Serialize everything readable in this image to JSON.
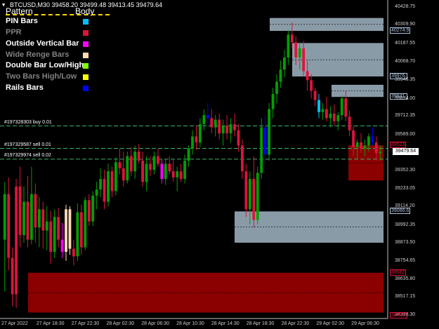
{
  "header": {
    "symbol_info": "BTCUSD,M30  39458.20  39499.48  39413.45  39479.64",
    "menu_arrow": "▼"
  },
  "legend": {
    "title_pattern": "Pattern",
    "title_body": "Body",
    "items": [
      {
        "label": "PIN Bars",
        "text_color": "#ffffff",
        "swatch": "#00bfff"
      },
      {
        "label": "PPR",
        "text_color": "#808080",
        "swatch": "#dc143c"
      },
      {
        "label": "Outside Vertical Bar",
        "text_color": "#ffffff",
        "swatch": "#ff00ff"
      },
      {
        "label": "Wide Renge Bars",
        "text_color": "#808080",
        "swatch": "#ffdab9"
      },
      {
        "label": "Double Bar Low/High",
        "text_color": "#ffffff",
        "swatch": "#7cfc00"
      },
      {
        "label": "Two Bars High/Low",
        "text_color": "#808080",
        "swatch": "#ffff00"
      },
      {
        "label": "Rails Bars",
        "text_color": "#ffffff",
        "swatch": "#0000ff"
      }
    ]
  },
  "orders": [
    {
      "label": "#197328303 buy 0.01",
      "price": 39649
    },
    {
      "label": "#197329587 sell 0.01",
      "price": 39501
    },
    {
      "label": "#197329974 sell 0.02",
      "price": 39430
    }
  ],
  "price_axis": {
    "ticks": [
      "40428.75",
      "40309.90",
      "40187.55",
      "40068.70",
      "39946.35",
      "39824.00",
      "39712.35",
      "39589.00",
      "39470.15",
      "39352.30",
      "39233.05",
      "39114.20",
      "38992.35",
      "38873.50",
      "38754.65",
      "38635.80",
      "38517.15",
      "38398.30"
    ],
    "current_price": "39479.64",
    "zone_labels": [
      {
        "text": "40274.9",
        "price": 40275,
        "color": "#b0c4de"
      },
      {
        "text": "39976.",
        "price": 39975,
        "color": "#b0c4de"
      },
      {
        "text": "39841.",
        "price": 39840,
        "color": "#b0c4de"
      },
      {
        "text": "39523",
        "price": 39521,
        "color": "#dc143c"
      },
      {
        "text": "39086.6",
        "price": 39086,
        "color": "#b0c4de"
      },
      {
        "text": "38682",
        "price": 38682,
        "color": "#dc143c"
      },
      {
        "text": "38400.",
        "price": 38400,
        "color": "#dc143c"
      }
    ]
  },
  "time_axis": {
    "ticks": [
      "27 Apr 2022",
      "27 Apr 18:30",
      "27 Apr 22:30",
      "28 Apr 02:30",
      "28 Apr 06:30",
      "28 Apr 10:30",
      "28 Apr 14:30",
      "28 Apr 18:30",
      "28 Apr 22:30",
      "29 Apr 02:30",
      "29 Apr 06:30"
    ]
  },
  "colors": {
    "bull": "#00a000",
    "bear": "#dc143c",
    "supply_zone": "#8a9ba8",
    "demand_zone": "#8b0000",
    "order_line": "#3cb371"
  },
  "chart_data": {
    "type": "candlestick",
    "ylim": [
      38390,
      40460
    ],
    "candles": [
      [
        38900,
        39280,
        38560,
        39200
      ],
      [
        39200,
        39310,
        38700,
        38780
      ],
      [
        38780,
        38850,
        38460,
        38540
      ],
      [
        38540,
        39300,
        38450,
        39250
      ],
      [
        39250,
        39380,
        38850,
        38930
      ],
      [
        38930,
        39250,
        38880,
        39150
      ],
      [
        39150,
        39320,
        38850,
        38900
      ],
      [
        38900,
        39380,
        38870,
        39200
      ],
      [
        39200,
        39270,
        38880,
        38980
      ],
      [
        38980,
        39180,
        38850,
        39100
      ],
      [
        39100,
        39150,
        38840,
        38960
      ],
      [
        38960,
        39120,
        38830,
        39020
      ],
      [
        39020,
        39090,
        38740,
        38820
      ],
      [
        38820,
        39100,
        38780,
        39050
      ],
      [
        39050,
        39110,
        38850,
        38900
      ],
      [
        38900,
        39010,
        38780,
        38820
      ],
      [
        38820,
        39130,
        38760,
        39100
      ],
      [
        39100,
        39120,
        38800,
        38840
      ],
      [
        38840,
        38900,
        38730,
        38790
      ],
      [
        38790,
        39140,
        38760,
        39080
      ],
      [
        39080,
        39130,
        38800,
        38850
      ],
      [
        38850,
        39180,
        38830,
        39160
      ],
      [
        39160,
        39200,
        38990,
        39020
      ],
      [
        39020,
        39220,
        38990,
        39190
      ],
      [
        39190,
        39280,
        39100,
        39230
      ],
      [
        39230,
        39370,
        39180,
        39300
      ],
      [
        39300,
        39360,
        39100,
        39150
      ],
      [
        39150,
        39400,
        39120,
        39350
      ],
      [
        39350,
        39380,
        39180,
        39220
      ],
      [
        39220,
        39440,
        39190,
        39410
      ],
      [
        39410,
        39500,
        39330,
        39370
      ],
      [
        39370,
        39480,
        39250,
        39290
      ],
      [
        39290,
        39480,
        39270,
        39450
      ],
      [
        39450,
        39510,
        39320,
        39350
      ],
      [
        39350,
        39520,
        39300,
        39480
      ],
      [
        39480,
        39530,
        39400,
        39420
      ],
      [
        39420,
        39480,
        39250,
        39280
      ],
      [
        39280,
        39450,
        39220,
        39400
      ],
      [
        39400,
        39450,
        39320,
        39360
      ],
      [
        39360,
        39480,
        39330,
        39450
      ],
      [
        39450,
        39500,
        39380,
        39400
      ],
      [
        39400,
        39430,
        39270,
        39300
      ],
      [
        39300,
        39430,
        39260,
        39400
      ],
      [
        39400,
        39450,
        39330,
        39350
      ],
      [
        39350,
        39430,
        39280,
        39310
      ],
      [
        39310,
        39380,
        39220,
        39350
      ],
      [
        39350,
        39400,
        39280,
        39300
      ],
      [
        39300,
        39460,
        39270,
        39420
      ],
      [
        39420,
        39520,
        39380,
        39500
      ],
      [
        39500,
        39620,
        39460,
        39580
      ],
      [
        39580,
        39650,
        39490,
        39540
      ],
      [
        39540,
        39700,
        39510,
        39660
      ],
      [
        39660,
        39760,
        39620,
        39720
      ],
      [
        39720,
        39800,
        39650,
        39700
      ],
      [
        39700,
        39760,
        39600,
        39640
      ],
      [
        39640,
        39720,
        39580,
        39690
      ],
      [
        39690,
        39730,
        39560,
        39600
      ],
      [
        39600,
        39690,
        39520,
        39650
      ],
      [
        39650,
        39720,
        39560,
        39600
      ],
      [
        39600,
        39700,
        39540,
        39660
      ],
      [
        39660,
        39730,
        39580,
        39620
      ],
      [
        39620,
        39660,
        39480,
        39520
      ],
      [
        39520,
        39560,
        39300,
        39350
      ],
      [
        39350,
        39400,
        39050,
        39100
      ],
      [
        39100,
        39350,
        39000,
        39300
      ],
      [
        39300,
        39450,
        38980,
        39030
      ],
      [
        39030,
        39380,
        39000,
        39340
      ],
      [
        39340,
        39700,
        39300,
        39640
      ],
      [
        39640,
        39720,
        39400,
        39460
      ],
      [
        39460,
        39800,
        39420,
        39760
      ],
      [
        39760,
        39900,
        39700,
        39860
      ],
      [
        39860,
        39990,
        39800,
        39940
      ],
      [
        39940,
        40080,
        39900,
        40020
      ],
      [
        40020,
        40150,
        39970,
        40100
      ],
      [
        40100,
        40280,
        40050,
        40250
      ],
      [
        40250,
        40330,
        40160,
        40200
      ],
      [
        40200,
        40240,
        40050,
        40100
      ],
      [
        40100,
        40200,
        40020,
        40160
      ],
      [
        40160,
        40210,
        39980,
        40010
      ],
      [
        40010,
        40080,
        39880,
        39950
      ],
      [
        39950,
        39990,
        39830,
        39880
      ],
      [
        39880,
        39900,
        39780,
        39820
      ],
      [
        39820,
        39860,
        39700,
        39740
      ],
      [
        39740,
        39800,
        39690,
        39760
      ],
      [
        39760,
        39840,
        39680,
        39700
      ],
      [
        39700,
        39780,
        39640,
        39730
      ],
      [
        39730,
        39790,
        39650,
        39680
      ],
      [
        39680,
        39740,
        39620,
        39720
      ],
      [
        39720,
        39850,
        39690,
        39830
      ],
      [
        39830,
        39880,
        39680,
        39710
      ],
      [
        39710,
        39750,
        39580,
        39620
      ],
      [
        39620,
        39650,
        39450,
        39510
      ],
      [
        39510,
        39560,
        39430,
        39540
      ],
      [
        39540,
        39600,
        39470,
        39500
      ],
      [
        39500,
        39560,
        39450,
        39520
      ],
      [
        39520,
        39600,
        39480,
        39580
      ],
      [
        39580,
        39640,
        39520,
        39540
      ],
      [
        39540,
        39580,
        39420,
        39470
      ],
      [
        39470,
        39520,
        39420,
        39480
      ]
    ]
  }
}
